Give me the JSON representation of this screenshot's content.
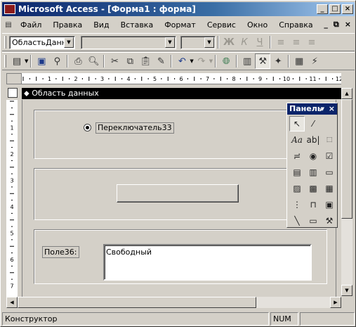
{
  "window": {
    "title": "Microsoft Access - [Форма1 : форма]"
  },
  "menu": [
    "Файл",
    "Правка",
    "Вид",
    "Вставка",
    "Формат",
    "Сервис",
    "Окно",
    "Справка"
  ],
  "toolbar1": {
    "object_combo": "ОбластьДанны"
  },
  "form": {
    "section_label": "Область данных",
    "radio_label": "Переключатель33",
    "field_label": "Поле36:",
    "textbox_value": "Свободный"
  },
  "toolbox": {
    "title": "Панель"
  },
  "status": {
    "mode": "Конструктор",
    "num": "NUM"
  },
  "ruler": {
    "h_marks": [
      "1",
      "2",
      "3",
      "4",
      "5",
      "6",
      "7",
      "8",
      "9",
      "10",
      "11",
      "12"
    ],
    "v_marks": [
      "1",
      "2",
      "3",
      "4",
      "5",
      "6",
      "7"
    ]
  }
}
